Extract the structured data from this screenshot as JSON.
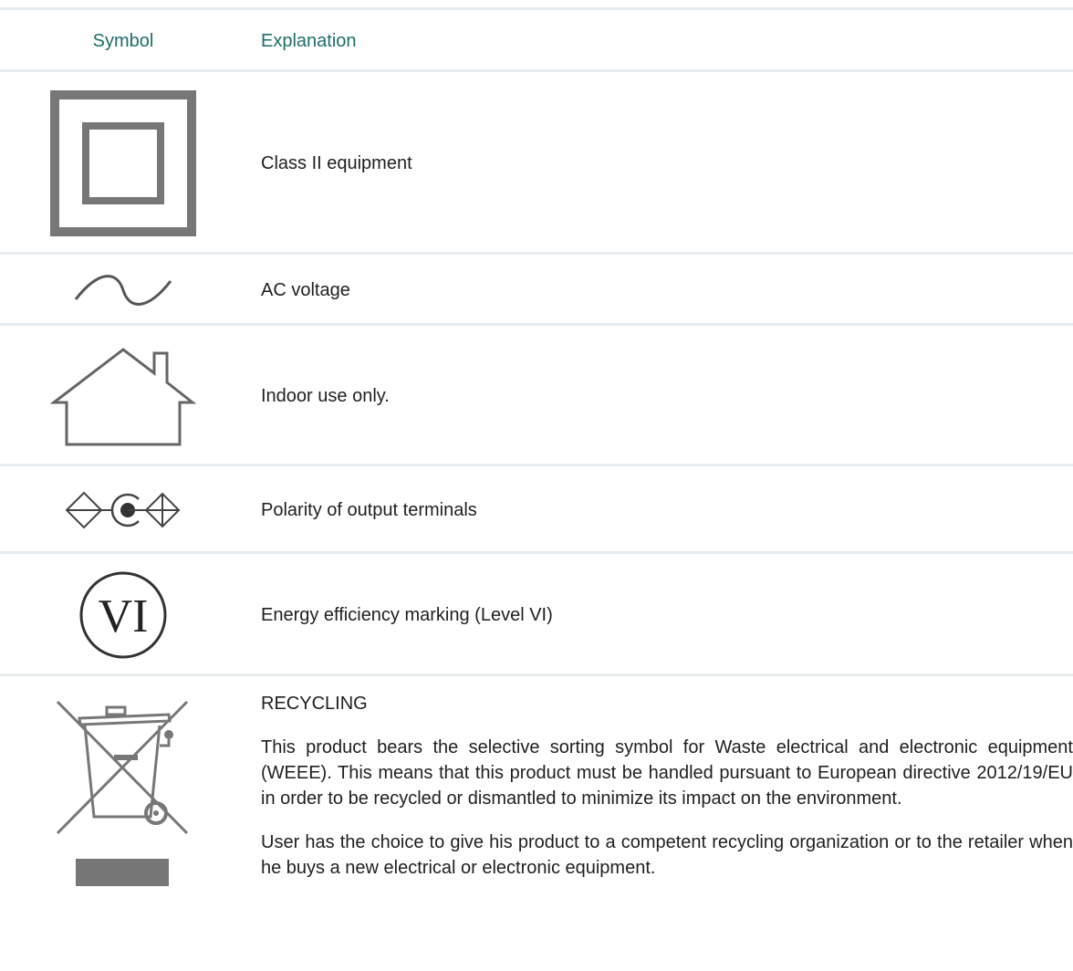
{
  "header": {
    "symbol_label": "Symbol",
    "explanation_label": "Explanation"
  },
  "rows": [
    {
      "icon": "double-square-icon",
      "text": "Class II equipment"
    },
    {
      "icon": "sine-wave-icon",
      "text": "AC voltage"
    },
    {
      "icon": "house-icon",
      "text": "Indoor use only."
    },
    {
      "icon": "polarity-icon",
      "text": "Polarity of output terminals"
    },
    {
      "icon": "energy-vi-icon",
      "text": "Energy efficiency marking (Level VI)",
      "icon_text": "VI"
    },
    {
      "icon": "crossed-bin-icon",
      "title": "RECYCLING",
      "paragraphs": [
        "This product bears the selective sorting symbol for Waste electrical and electronic equipment (WEEE). This means that this product must be handled pursuant to European directive 2012/19/EU in order to be recycled or dismantled to minimize its impact on the environment.",
        "User has the choice to give his product to a competent recycling organization or to the retailer when he buys a new electrical or electronic equipment."
      ]
    }
  ],
  "colors": {
    "header_text": "#1e6e6a",
    "divider": "#e6edf1",
    "icon_gray": "#777777"
  }
}
